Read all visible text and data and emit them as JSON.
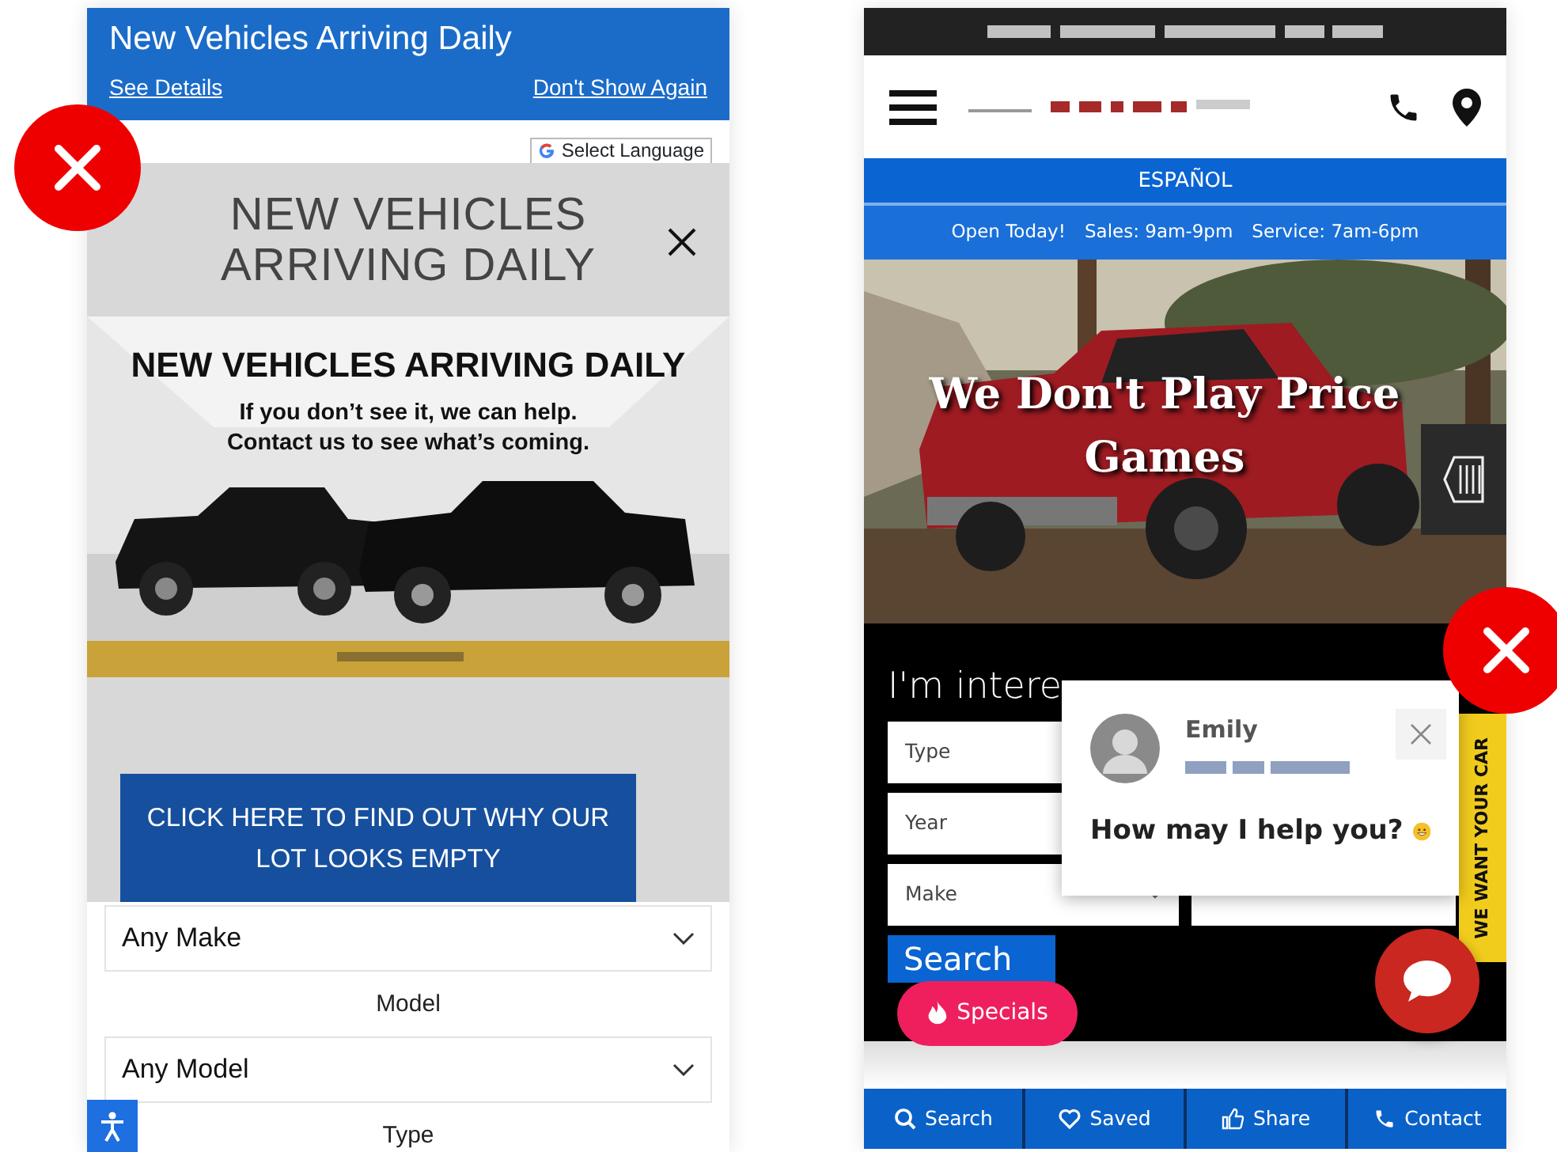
{
  "left_screen": {
    "notice_bar": {
      "title": "New Vehicles Arriving Daily",
      "links": [
        "See Details",
        "Don't Show Again"
      ]
    },
    "language_select": {
      "label": "Select Language"
    },
    "modal": {
      "title_lines": [
        "NEW VEHICLES",
        "ARRIVING DAILY"
      ],
      "promo": {
        "heading": "NEW VEHICLES ARRIVING DAILY",
        "subtext_lines": [
          "If you don’t see it, we can help.",
          "Contact us to see what’s coming."
        ]
      },
      "button_lines": [
        "CLICK HERE TO FIND OUT WHY OUR",
        "LOT LOOKS EMPTY"
      ]
    },
    "filters": [
      {
        "kind": "select",
        "value": "Any Make"
      },
      {
        "kind": "label",
        "text": "Model"
      },
      {
        "kind": "select",
        "value": "Any Model"
      },
      {
        "kind": "label",
        "text": "Type"
      }
    ]
  },
  "right_screen": {
    "language_bar": "ESPAÑOL",
    "hours": [
      "Open Today!",
      "Sales: 9am-9pm",
      "Service: 7am-6pm"
    ],
    "hero": {
      "headline_lines": [
        "We Don't Play Price",
        "Games"
      ]
    },
    "form": {
      "title": "I'm intere",
      "fields": [
        {
          "placeholder": "Type"
        },
        {
          "placeholder": "Year"
        },
        {
          "placeholder": "Make"
        }
      ],
      "button": "Search"
    },
    "side_tab": "WE WANT YOUR CAR",
    "chat": {
      "name": "Emily",
      "message": "How may I help you?"
    },
    "specials_button": "Specials",
    "bottom_nav": [
      {
        "kind": "search",
        "label": "Search"
      },
      {
        "kind": "saved",
        "label": "Saved"
      },
      {
        "kind": "share",
        "label": "Share"
      },
      {
        "kind": "contact",
        "label": "Contact"
      }
    ]
  }
}
